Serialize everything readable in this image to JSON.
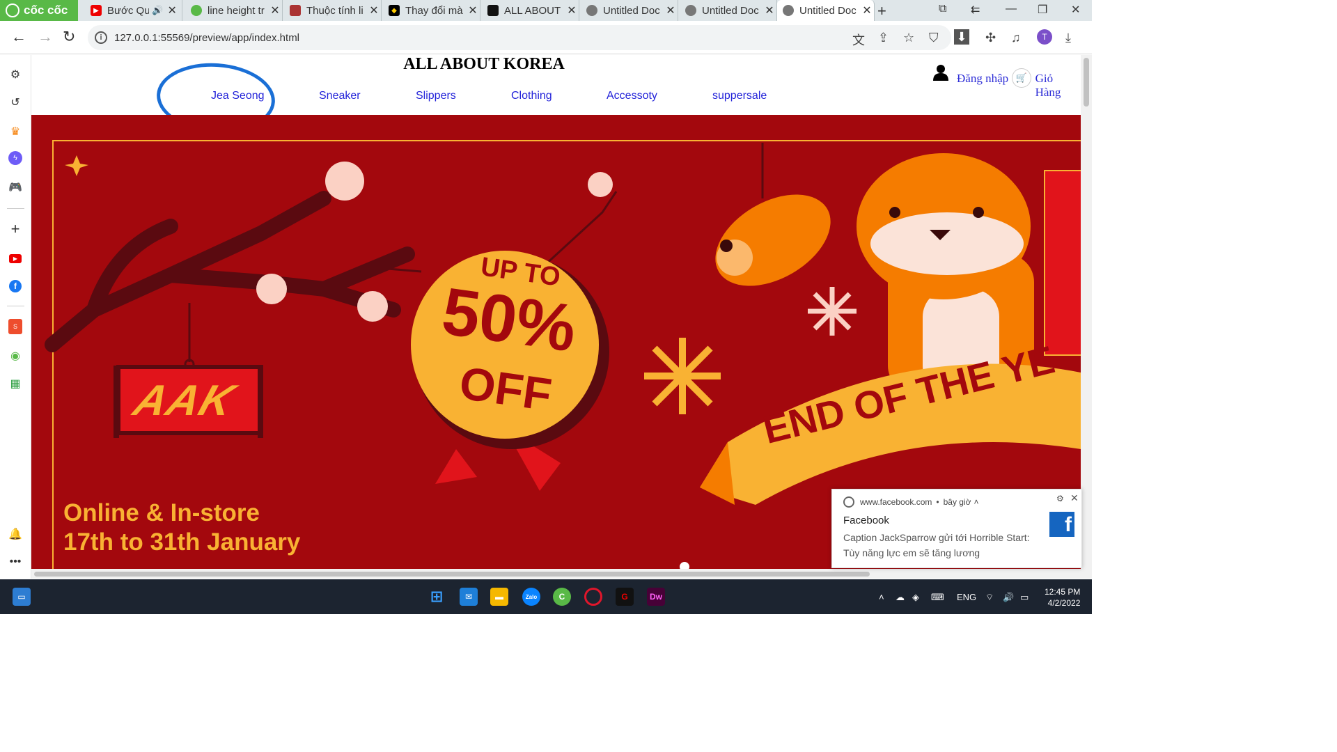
{
  "browser": {
    "brand": "cốc cốc",
    "tabs": [
      {
        "label": "Bước Qu",
        "icon": "youtube-icon"
      },
      {
        "label": "line height tr",
        "icon": "coccoc-icon"
      },
      {
        "label": "Thuộc tính li",
        "icon": "site-icon"
      },
      {
        "label": "Thay đổi mà",
        "icon": "cat-icon"
      },
      {
        "label": "ALL ABOUT I",
        "icon": "site-icon"
      },
      {
        "label": "Untitled Doc",
        "icon": "globe-icon"
      },
      {
        "label": "Untitled Doc",
        "icon": "globe-icon"
      },
      {
        "label": "Untitled Doc",
        "icon": "globe-icon"
      }
    ],
    "url": "127.0.0.1:55569/preview/app/index.html",
    "profile_initial": "T"
  },
  "site": {
    "title": "ALL ABOUT KOREA",
    "login": "Đăng nhập",
    "cart": "Giỏ Hàng",
    "menu": [
      "Jea Seong",
      "Sneaker",
      "Slippers",
      "Clothing",
      "Accessoty",
      "suppersale"
    ]
  },
  "banner": {
    "sign": "AAK",
    "badge_line1": "UP TO",
    "badge_line2": "50%",
    "badge_line3": "OFF",
    "ribbon": "END OF THE YE",
    "footer_line1": "Online & In-store",
    "footer_line2": "17th to 31th January",
    "colors": {
      "bg": "#a3080d",
      "gold": "#f9b233",
      "orange": "#f57c00"
    }
  },
  "notification": {
    "source": "www.facebook.com",
    "time": "bây giờ",
    "title": "Facebook",
    "message": "Caption JackSparrow gửi tới Horrible Start: Tùy năng lực em sẽ tăng lương"
  },
  "taskbar": {
    "lang": "ENG",
    "time": "12:45 PM",
    "date": "4/2/2022"
  }
}
